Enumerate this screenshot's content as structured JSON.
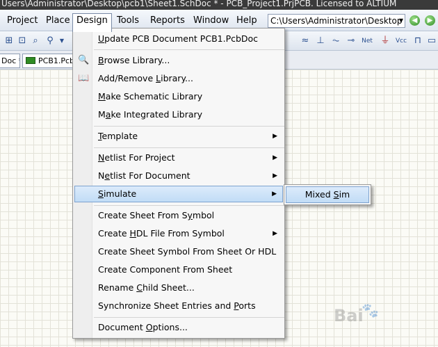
{
  "window": {
    "title": "Users\\Administrator\\Desktop\\pcb1\\Sheet1.SchDoc * - PCB_Project1.PrjPCB. Licensed to ALTIUM"
  },
  "menubar": {
    "items": [
      {
        "label": "Project",
        "u": "j"
      },
      {
        "label": "Place",
        "u": "P"
      },
      {
        "label": "Design",
        "u": "D"
      },
      {
        "label": "Tools",
        "u": "T"
      },
      {
        "label": "Reports",
        "u": "R"
      },
      {
        "label": "Window",
        "u": "W"
      },
      {
        "label": "Help",
        "u": "H"
      }
    ],
    "path": "C:\\Users\\Administrator\\Desktop"
  },
  "tabs": [
    {
      "label": "Doc *"
    },
    {
      "label": "PCB1.Pcb"
    }
  ],
  "design_menu": {
    "items": [
      {
        "pre": "",
        "u": "U",
        "post": "pdate PCB Document PCB1.PcbDoc"
      },
      {
        "pre": "",
        "u": "B",
        "post": "rowse Library..."
      },
      {
        "pre": "Add/Remove ",
        "u": "L",
        "post": "ibrary..."
      },
      {
        "pre": "",
        "u": "M",
        "post": "ake Schematic Library"
      },
      {
        "pre": "M",
        "u": "a",
        "post": "ke Integrated Library"
      },
      {
        "pre": "",
        "u": "T",
        "post": "emplate"
      },
      {
        "pre": "",
        "u": "N",
        "post": "etlist For Project"
      },
      {
        "pre": "N",
        "u": "e",
        "post": "tlist For Document"
      },
      {
        "pre": "",
        "u": "S",
        "post": "imulate"
      },
      {
        "pre": "Create Sheet From S",
        "u": "y",
        "post": "mbol"
      },
      {
        "pre": "Create ",
        "u": "H",
        "post": "DL File From Symbol"
      },
      {
        "pre": "Create Sheet Symbol From Sheet Or HDL",
        "u": "",
        "post": ""
      },
      {
        "pre": "Create Component From Sheet",
        "u": "",
        "post": ""
      },
      {
        "pre": "Rename ",
        "u": "C",
        "post": "hild Sheet..."
      },
      {
        "pre": "Synchronize Sheet Entries and ",
        "u": "P",
        "post": "orts"
      },
      {
        "pre": "Document ",
        "u": "O",
        "post": "ptions..."
      }
    ]
  },
  "simulate_submenu": {
    "item": {
      "pre": "Mixed ",
      "u": "S",
      "post": "im"
    }
  },
  "watermark": {
    "text": "Bai"
  },
  "colors": {
    "highlight": "#c1dcf6",
    "highlight_border": "#7da2ce"
  }
}
